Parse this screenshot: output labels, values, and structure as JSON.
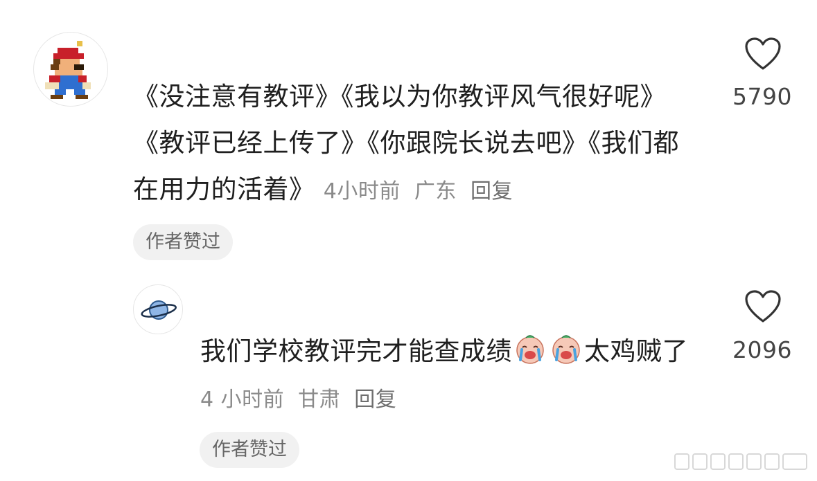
{
  "comments": [
    {
      "text": "《没注意有教评》《我以为你教评风气很好呢》《教评已经上传了》《你跟院长说去吧》《我们都在用力的活着》",
      "time": "4小时前",
      "location": "广东",
      "reply_label": "回复",
      "badge": "作者赞过",
      "likes": "5790",
      "avatar": "pixel-mario-avatar"
    },
    {
      "text_before": "我们学校教评完才能查成绩",
      "emojis": [
        "crying-emoji",
        "crying-emoji"
      ],
      "text_after": "太鸡贼了",
      "time": "4 小时前",
      "location": "甘肃",
      "reply_label": "回复",
      "badge": "作者赞过",
      "likes": "2096",
      "avatar": "planet-avatar"
    }
  ],
  "icons": {
    "like": "heart-outline-icon"
  },
  "colors": {
    "meta": "#8a8a8a",
    "badge_bg": "#f1f1f1",
    "text": "#1f1f1f"
  }
}
